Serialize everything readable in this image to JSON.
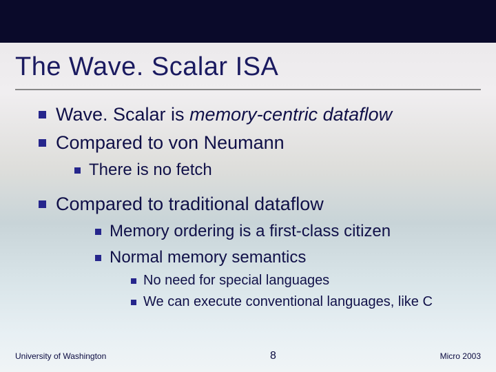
{
  "title": "The Wave. Scalar ISA",
  "bullets": {
    "b1_pre": "Wave. Scalar is ",
    "b1_em": "memory-centric dataflow",
    "b2": "Compared to von Neumann",
    "b2_1": "There is no fetch",
    "b3": "Compared to traditional dataflow",
    "b3_1": "Memory ordering is a first-class citizen",
    "b3_2": "Normal memory semantics",
    "b3_2_1": "No need for special languages",
    "b3_2_2": "We can execute conventional languages, like C"
  },
  "footer": {
    "left": "University of Washington",
    "center": "8",
    "right": "Micro 2003"
  }
}
